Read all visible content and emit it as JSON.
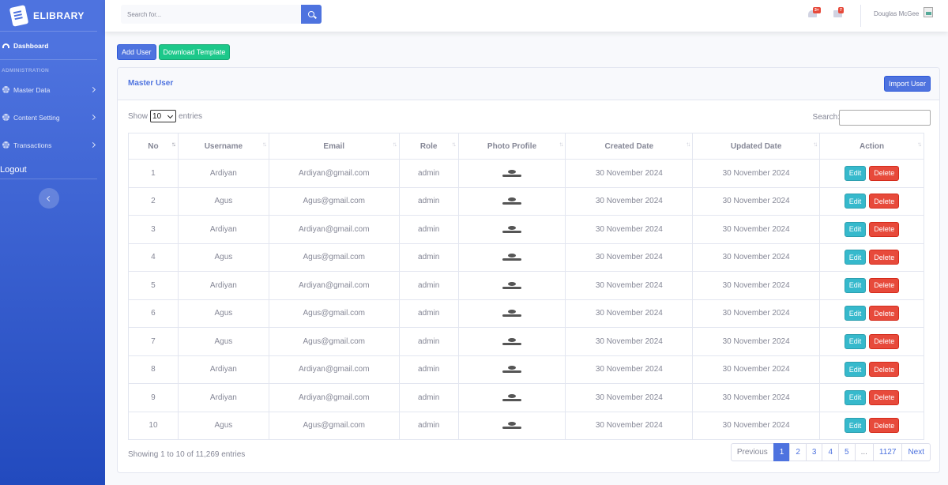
{
  "brand": {
    "name": "ELIBRARY"
  },
  "sidebar": {
    "dashboard": "Dashboard",
    "heading": "ADMINISTRATION",
    "items": [
      {
        "label": "Master Data",
        "icon": "gear-icon"
      },
      {
        "label": "Content Setting",
        "icon": "gear-icon"
      },
      {
        "label": "Transactions",
        "icon": "gear-icon"
      }
    ],
    "logout": "Logout"
  },
  "topbar": {
    "search_placeholder": "Search for...",
    "alerts_badge": "3+",
    "messages_badge": "7",
    "user_name": "Douglas McGee"
  },
  "actions": {
    "add_user": "Add User",
    "download_template": "Download Template"
  },
  "card": {
    "title": "Master User",
    "import_label": "Import User"
  },
  "table_controls": {
    "show_label": "Show",
    "page_size": "10",
    "entries_label": "entries",
    "search_label": "Search:"
  },
  "columns": [
    "No",
    "Username",
    "Email",
    "Role",
    "Photo Profile",
    "Created Date",
    "Updated Date",
    "Action"
  ],
  "rows": [
    {
      "no": "1",
      "username": "Ardiyan",
      "email": "Ardiyan@gmail.com",
      "role": "admin",
      "created": "30 November 2024",
      "updated": "30 November 2024"
    },
    {
      "no": "2",
      "username": "Agus",
      "email": "Agus@gmail.com",
      "role": "admin",
      "created": "30 November 2024",
      "updated": "30 November 2024"
    },
    {
      "no": "3",
      "username": "Ardiyan",
      "email": "Ardiyan@gmail.com",
      "role": "admin",
      "created": "30 November 2024",
      "updated": "30 November 2024"
    },
    {
      "no": "4",
      "username": "Agus",
      "email": "Agus@gmail.com",
      "role": "admin",
      "created": "30 November 2024",
      "updated": "30 November 2024"
    },
    {
      "no": "5",
      "username": "Ardiyan",
      "email": "Ardiyan@gmail.com",
      "role": "admin",
      "created": "30 November 2024",
      "updated": "30 November 2024"
    },
    {
      "no": "6",
      "username": "Agus",
      "email": "Agus@gmail.com",
      "role": "admin",
      "created": "30 November 2024",
      "updated": "30 November 2024"
    },
    {
      "no": "7",
      "username": "Agus",
      "email": "Agus@gmail.com",
      "role": "admin",
      "created": "30 November 2024",
      "updated": "30 November 2024"
    },
    {
      "no": "8",
      "username": "Ardiyan",
      "email": "Ardiyan@gmail.com",
      "role": "admin",
      "created": "30 November 2024",
      "updated": "30 November 2024"
    },
    {
      "no": "9",
      "username": "Ardiyan",
      "email": "Ardiyan@gmail.com",
      "role": "admin",
      "created": "30 November 2024",
      "updated": "30 November 2024"
    },
    {
      "no": "10",
      "username": "Agus",
      "email": "Agus@gmail.com",
      "role": "admin",
      "created": "30 November 2024",
      "updated": "30 November 2024"
    }
  ],
  "row_actions": {
    "edit": "Edit",
    "delete": "Delete"
  },
  "footer": {
    "info": "Showing 1 to 10 of 11,269 entries",
    "previous": "Previous",
    "pages": [
      "1",
      "2",
      "3",
      "4",
      "5",
      "...",
      "1127"
    ],
    "active_page": "1",
    "next": "Next"
  },
  "colors": {
    "primary": "#4e73df",
    "success": "#1cc88a",
    "info": "#36b9cc",
    "danger": "#e74a3b"
  }
}
